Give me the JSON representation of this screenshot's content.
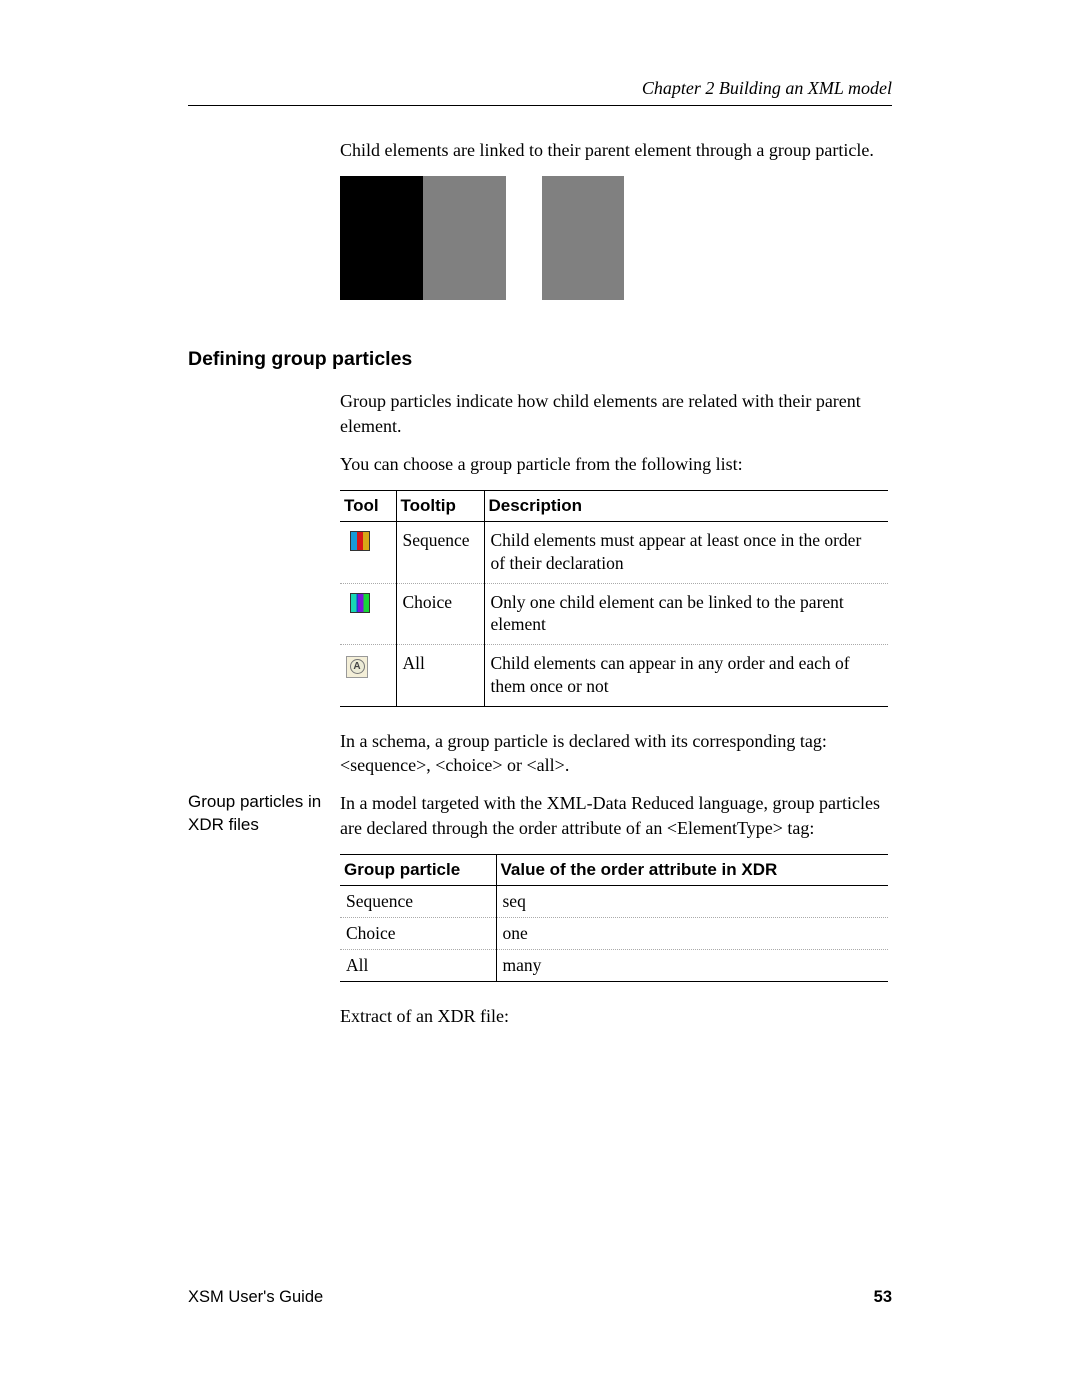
{
  "chapter": "Chapter 2  Building an XML model",
  "intro_para": "Child elements are linked to their parent element through a group particle.",
  "heading": "Defining group particles",
  "para1": "Group particles indicate how child elements are related with their parent element.",
  "para2": "You can choose a group particle from the following list:",
  "table1": {
    "headers": {
      "c1": "Tool",
      "c2": "Tooltip",
      "c3": "Description"
    },
    "rows": [
      {
        "tooltip": "Sequence",
        "description": "Child elements must appear at least once in the order of their declaration",
        "icon": "sequence-tool-icon"
      },
      {
        "tooltip": "Choice",
        "description": "Only one child element can be linked to the parent element",
        "icon": "choice-tool-icon"
      },
      {
        "tooltip": "All",
        "description": "Child elements can appear in any order and each of them once or not",
        "icon": "all-tool-icon"
      }
    ]
  },
  "para3": "In a schema, a group particle is declared with its corresponding tag: <sequence>, <choice> or <all>.",
  "sidebar_label": "Group particles in XDR files",
  "para4": "In a model targeted with the XML-Data Reduced language, group particles are declared through the order attribute of an <ElementType> tag:",
  "table2": {
    "headers": {
      "c1": "Group particle",
      "c2": "Value of the order attribute in XDR"
    },
    "rows": [
      {
        "particle": "Sequence",
        "value": "seq"
      },
      {
        "particle": "Choice",
        "value": "one"
      },
      {
        "particle": "All",
        "value": "many"
      }
    ]
  },
  "para5": "Extract of an XDR file:",
  "footer": {
    "guide": "XSM User's Guide",
    "page": "53"
  }
}
